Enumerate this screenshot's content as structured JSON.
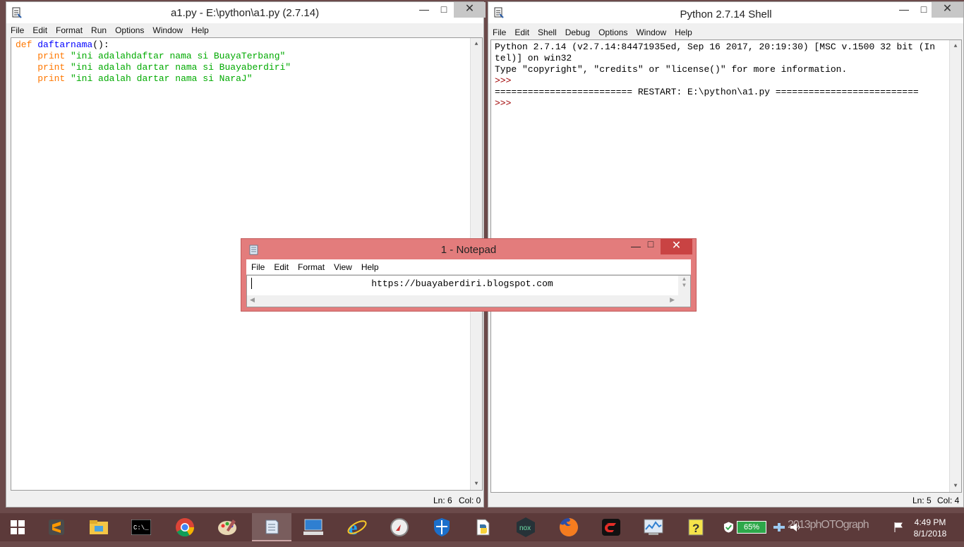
{
  "editor_window": {
    "title": "a1.py - E:\\python\\a1.py (2.7.14)",
    "menu": [
      "File",
      "Edit",
      "Format",
      "Run",
      "Options",
      "Window",
      "Help"
    ],
    "code": {
      "l1_kw": "def",
      "l1_fn": "daftarnama",
      "l1_rest": "():",
      "l2_kw": "print",
      "l2_str": "\"ini adalahdaftar nama si BuayaTerbang\"",
      "l3_kw": "print",
      "l3_str": "\"ini adalah dartar nama si Buayaberdiri\"",
      "l4_kw": "print",
      "l4_str": "\"ini adalah dartar nama si NaraJ\""
    },
    "status": {
      "ln": "Ln: 6",
      "col": "Col: 0"
    }
  },
  "shell_window": {
    "title": "Python 2.7.14 Shell",
    "menu": [
      "File",
      "Edit",
      "Shell",
      "Debug",
      "Options",
      "Window",
      "Help"
    ],
    "lines": {
      "l1": "Python 2.7.14 (v2.7.14:84471935ed, Sep 16 2017, 20:19:30) [MSC v.1500 32 bit (In",
      "l2": "tel)] on win32",
      "l3": "Type \"copyright\", \"credits\" or \"license()\" for more information.",
      "l4": ">>> ",
      "l5": "========================= RESTART: E:\\python\\a1.py ==========================",
      "l6": ">>> "
    },
    "status": {
      "ln": "Ln: 5",
      "col": "Col: 4"
    }
  },
  "notepad": {
    "title": "1 - Notepad",
    "menu": [
      "File",
      "Edit",
      "Format",
      "View",
      "Help"
    ],
    "content": "https://buayaberdiri.blogspot.com"
  },
  "window_controls": {
    "minimize": "—",
    "maximize": "□",
    "close": "✕"
  },
  "taskbar": {
    "apps": [
      "windows-start",
      "sublime-text",
      "file-explorer",
      "command-prompt",
      "chrome",
      "paint",
      "notepad",
      "remote-desktop",
      "internet-explorer",
      "compass",
      "windows-defender",
      "python-idle",
      "nox-player",
      "firefox",
      "garena",
      "task-manager",
      "help"
    ],
    "battery": "65%",
    "watermark": "2013phOTOgraph",
    "time": "4:49 PM",
    "date": "8/1/2018"
  },
  "colors": {
    "taskbar": "#5c3a3a",
    "notepad_frame": "#e37c7c",
    "keyword": "#ff7700",
    "string": "#00aa00",
    "prompt": "#a00000"
  }
}
